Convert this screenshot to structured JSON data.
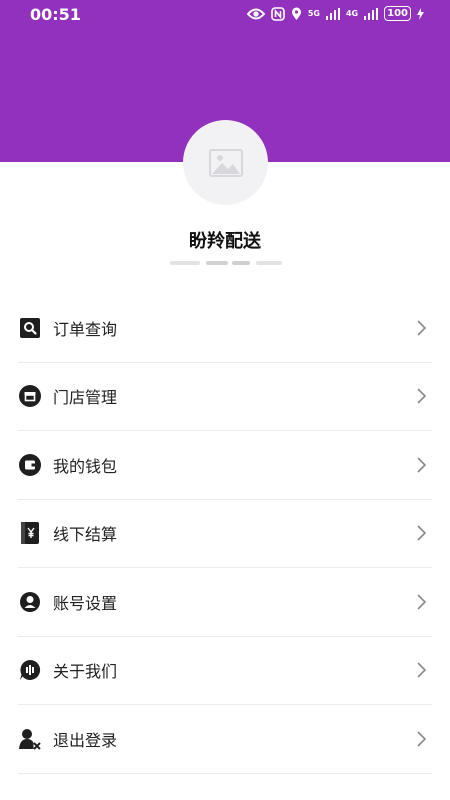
{
  "status_bar": {
    "time": "00:51",
    "network1": "5G",
    "network2": "4G",
    "battery": "100"
  },
  "profile": {
    "name": "盼羚配送"
  },
  "menu": {
    "items": [
      {
        "label": "订单查询",
        "icon": "search-order-icon"
      },
      {
        "label": "门店管理",
        "icon": "store-icon"
      },
      {
        "label": "我的钱包",
        "icon": "wallet-icon"
      },
      {
        "label": "线下结算",
        "icon": "settlement-icon"
      },
      {
        "label": "账号设置",
        "icon": "account-icon"
      },
      {
        "label": "关于我们",
        "icon": "about-icon"
      },
      {
        "label": "退出登录",
        "icon": "logout-icon"
      }
    ]
  },
  "colors": {
    "header": "#9131bd",
    "divider": "#ececec",
    "icon": "#1f1f1f",
    "chevron": "#888888"
  }
}
